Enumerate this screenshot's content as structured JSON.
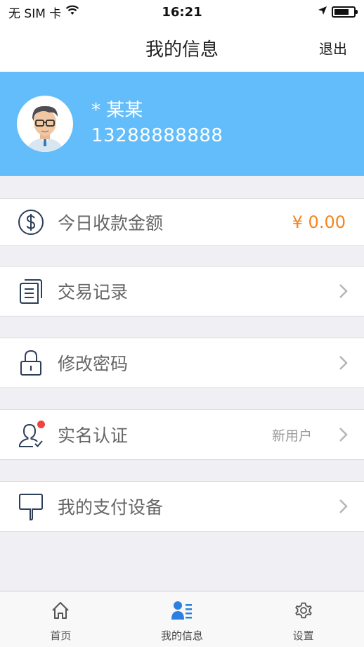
{
  "status_bar": {
    "carrier": "无 SIM 卡",
    "time": "16:21",
    "battery_level": 0.75
  },
  "nav": {
    "title": "我的信息",
    "logout_label": "退出"
  },
  "profile": {
    "name": "* 某某",
    "phone": "13288888888"
  },
  "list": {
    "today_income": {
      "icon": "dollar-circle-icon",
      "label": "今日收款金额",
      "value": "¥ 0.00"
    },
    "transactions": {
      "icon": "document-stack-icon",
      "label": "交易记录"
    },
    "change_password": {
      "icon": "lock-icon",
      "label": "修改密码"
    },
    "verification": {
      "icon": "user-verify-icon",
      "label": "实名认证",
      "status": "新用户"
    },
    "payment_devices": {
      "icon": "device-icon",
      "label": "我的支付设备"
    }
  },
  "tabs": [
    {
      "icon": "home-icon",
      "label": "首页"
    },
    {
      "icon": "profile-list-icon",
      "label": "我的信息"
    },
    {
      "icon": "gear-icon",
      "label": "设置"
    }
  ],
  "colors": {
    "banner": "#63bdfb",
    "accent": "#f5841f",
    "icon_stroke": "#2c3e58",
    "tab_active": "#2d7fe0",
    "badge": "#f1433f"
  }
}
